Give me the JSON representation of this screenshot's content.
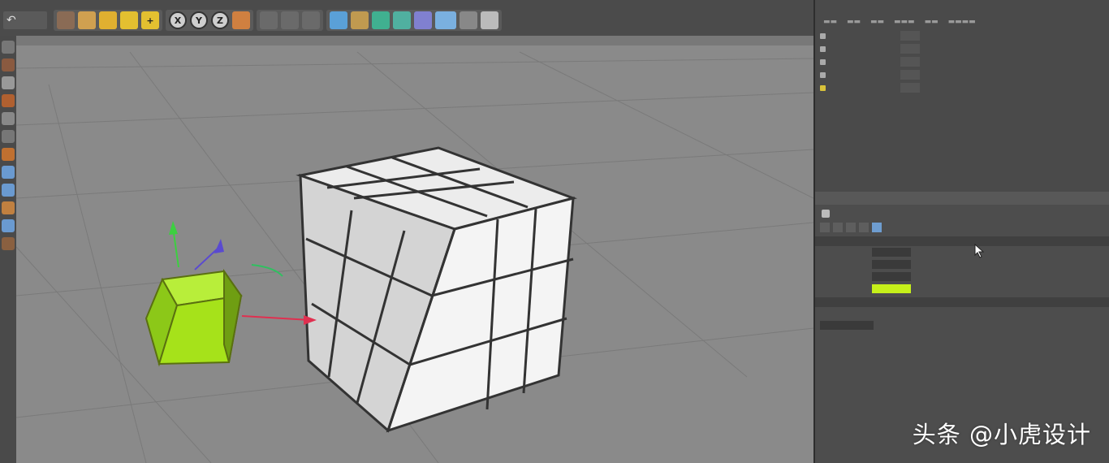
{
  "toolbar": {
    "axis_x": "X",
    "axis_y": "Y",
    "axis_z": "Z",
    "add": "+",
    "undo_icon": "undo-icon"
  },
  "watermark": "头条 @小虎设计",
  "colors": {
    "viewport_bg": "#8a8a8a",
    "panel_bg": "#4a4a4a",
    "selected_cube": "#a6e21a",
    "active_tab": "#6e9dd0",
    "selected_object": "#d8c23a",
    "color_swatch": "#c6f01a"
  },
  "icons": [
    "undo-icon",
    "move-icon",
    "scale-icon",
    "rotate-icon",
    "add-icon",
    "axis-x-icon",
    "axis-y-icon",
    "axis-z-icon",
    "render-icon",
    "cube-primitive-icon",
    "pen-icon",
    "generator-icon",
    "deformer-icon",
    "camera-icon",
    "light-icon",
    "cursor-icon"
  ]
}
